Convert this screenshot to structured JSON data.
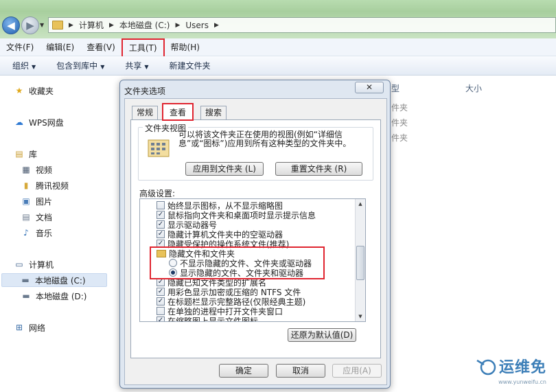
{
  "address": {
    "crumbs": [
      "计算机",
      "本地磁盘 (C:)",
      "Users"
    ]
  },
  "menu": {
    "file": "文件(F)",
    "edit": "编辑(E)",
    "view": "查看(V)",
    "tools": "工具(T)",
    "help": "帮助(H)"
  },
  "toolbar": {
    "organize": "组织",
    "include": "包含到库中",
    "share": "共享",
    "new_folder": "新建文件夹"
  },
  "nav": {
    "favorites": "收藏夹",
    "wps": "WPS网盘",
    "libraries": "库",
    "videos": "视频",
    "tencent_video": "腾讯视频",
    "pictures": "图片",
    "documents": "文档",
    "music": "音乐",
    "computer": "计算机",
    "drive_c": "本地磁盘 (C:)",
    "drive_d": "本地磁盘 (D:)",
    "network": "网络"
  },
  "content": {
    "col_type": "型",
    "col_size": "大小",
    "rows": [
      "件夹",
      "件夹",
      "件夹"
    ]
  },
  "dialog": {
    "title": "文件夹选项",
    "close": "✕",
    "tabs": {
      "general": "常规",
      "view": "查看",
      "search": "搜索"
    },
    "folder_view": {
      "legend": "文件夹视图",
      "description": "可以将该文件夹正在使用的视图(例如“详细信息”或“图标”)应用到所有这种类型的文件夹中。",
      "apply_button": "应用到文件夹 (L)",
      "reset_button": "重置文件夹 (R)"
    },
    "advanced_label": "高级设置:",
    "advanced_items": [
      {
        "kind": "checkbox",
        "checked": false,
        "label": "始终显示图标，从不显示缩略图"
      },
      {
        "kind": "checkbox",
        "checked": true,
        "label": "鼠标指向文件夹和桌面项时显示提示信息"
      },
      {
        "kind": "checkbox",
        "checked": true,
        "label": "显示驱动器号"
      },
      {
        "kind": "checkbox",
        "checked": true,
        "label": "隐藏计算机文件夹中的空驱动器"
      },
      {
        "kind": "checkbox",
        "checked": true,
        "label": "隐藏受保护的操作系统文件(推荐)"
      },
      {
        "kind": "folder",
        "label": "隐藏文件和文件夹"
      },
      {
        "kind": "radio",
        "checked": false,
        "label": "不显示隐藏的文件、文件夹或驱动器"
      },
      {
        "kind": "radio",
        "checked": true,
        "label": "显示隐藏的文件、文件夹和驱动器"
      },
      {
        "kind": "checkbox",
        "checked": true,
        "label": "隐藏已知文件类型的扩展名"
      },
      {
        "kind": "checkbox",
        "checked": true,
        "label": "用彩色显示加密或压缩的 NTFS 文件"
      },
      {
        "kind": "checkbox",
        "checked": true,
        "label": "在标题栏显示完整路径(仅限经典主题)"
      },
      {
        "kind": "checkbox",
        "checked": false,
        "label": "在单独的进程中打开文件夹窗口"
      },
      {
        "kind": "checkbox",
        "checked": true,
        "label": "在缩略图上显示文件图标"
      }
    ],
    "restore_button": "还原为默认值(D)",
    "ok_button": "确定",
    "cancel_button": "取消",
    "apply_button": "应用(A)"
  },
  "watermark": {
    "title": "运维免",
    "url": "www.yunweifu.cn"
  },
  "colors": {
    "highlight": "#e0242f",
    "title_bar": "#dfe7f1",
    "address_bg": "#a8cf9e"
  }
}
